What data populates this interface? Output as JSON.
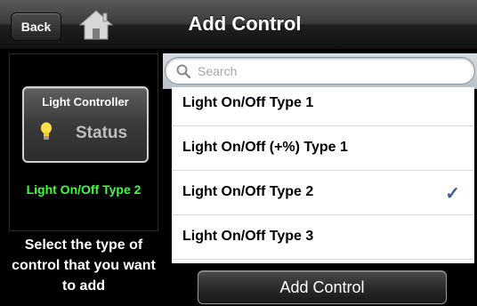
{
  "header": {
    "back_label": "Back",
    "home_icon": "home-icon",
    "title": "Add Control"
  },
  "preview": {
    "title": "Light Controller",
    "bulb_icon": "light-bulb-icon",
    "status": "Status",
    "selected_type": "Light On/Off Type 2"
  },
  "instructions": "Select the type of control that you want to add",
  "search": {
    "placeholder": "Search",
    "value": "",
    "icon": "search-icon"
  },
  "list": {
    "items": [
      {
        "label": "Light On/Off Type 1",
        "selected": false
      },
      {
        "label": "Light On/Off (+%) Type 1",
        "selected": false
      },
      {
        "label": "Light On/Off Type 2",
        "selected": true
      },
      {
        "label": "Light On/Off Type 3",
        "selected": false
      }
    ],
    "check_glyph": "✓",
    "check_color": "#3a5f9a"
  },
  "footer": {
    "add_button_label": "Add Control"
  },
  "colors": {
    "selected_type_text": "#3cff3c"
  }
}
